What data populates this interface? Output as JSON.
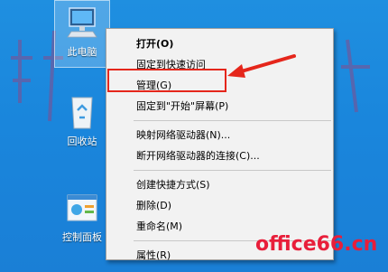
{
  "desktop": {
    "icons": [
      {
        "label": "此电脑",
        "icon": "computer-icon"
      },
      {
        "label": "回收站",
        "icon": "recycle-bin-icon"
      },
      {
        "label": "控制面板",
        "icon": "control-panel-icon"
      }
    ]
  },
  "context_menu": {
    "items": {
      "open": "打开(O)",
      "pin_quick_access": "固定到快速访问",
      "manage": "管理(G)",
      "pin_start": "固定到\"开始\"屏幕(P)",
      "map_drive": "映射网络驱动器(N)...",
      "disconnect_drive": "断开网络驱动器的连接(C)...",
      "create_shortcut": "创建快捷方式(S)",
      "delete": "删除(D)",
      "rename": "重命名(M)",
      "properties": "属性(R)"
    }
  },
  "annotation": {
    "highlight_color": "#e5261b"
  },
  "watermark": {
    "brand": "office66.cn",
    "brand_color": "#e81e3a"
  },
  "colors": {
    "desktop_bg": "#1a86dc",
    "menu_bg": "#f2f2f2"
  }
}
